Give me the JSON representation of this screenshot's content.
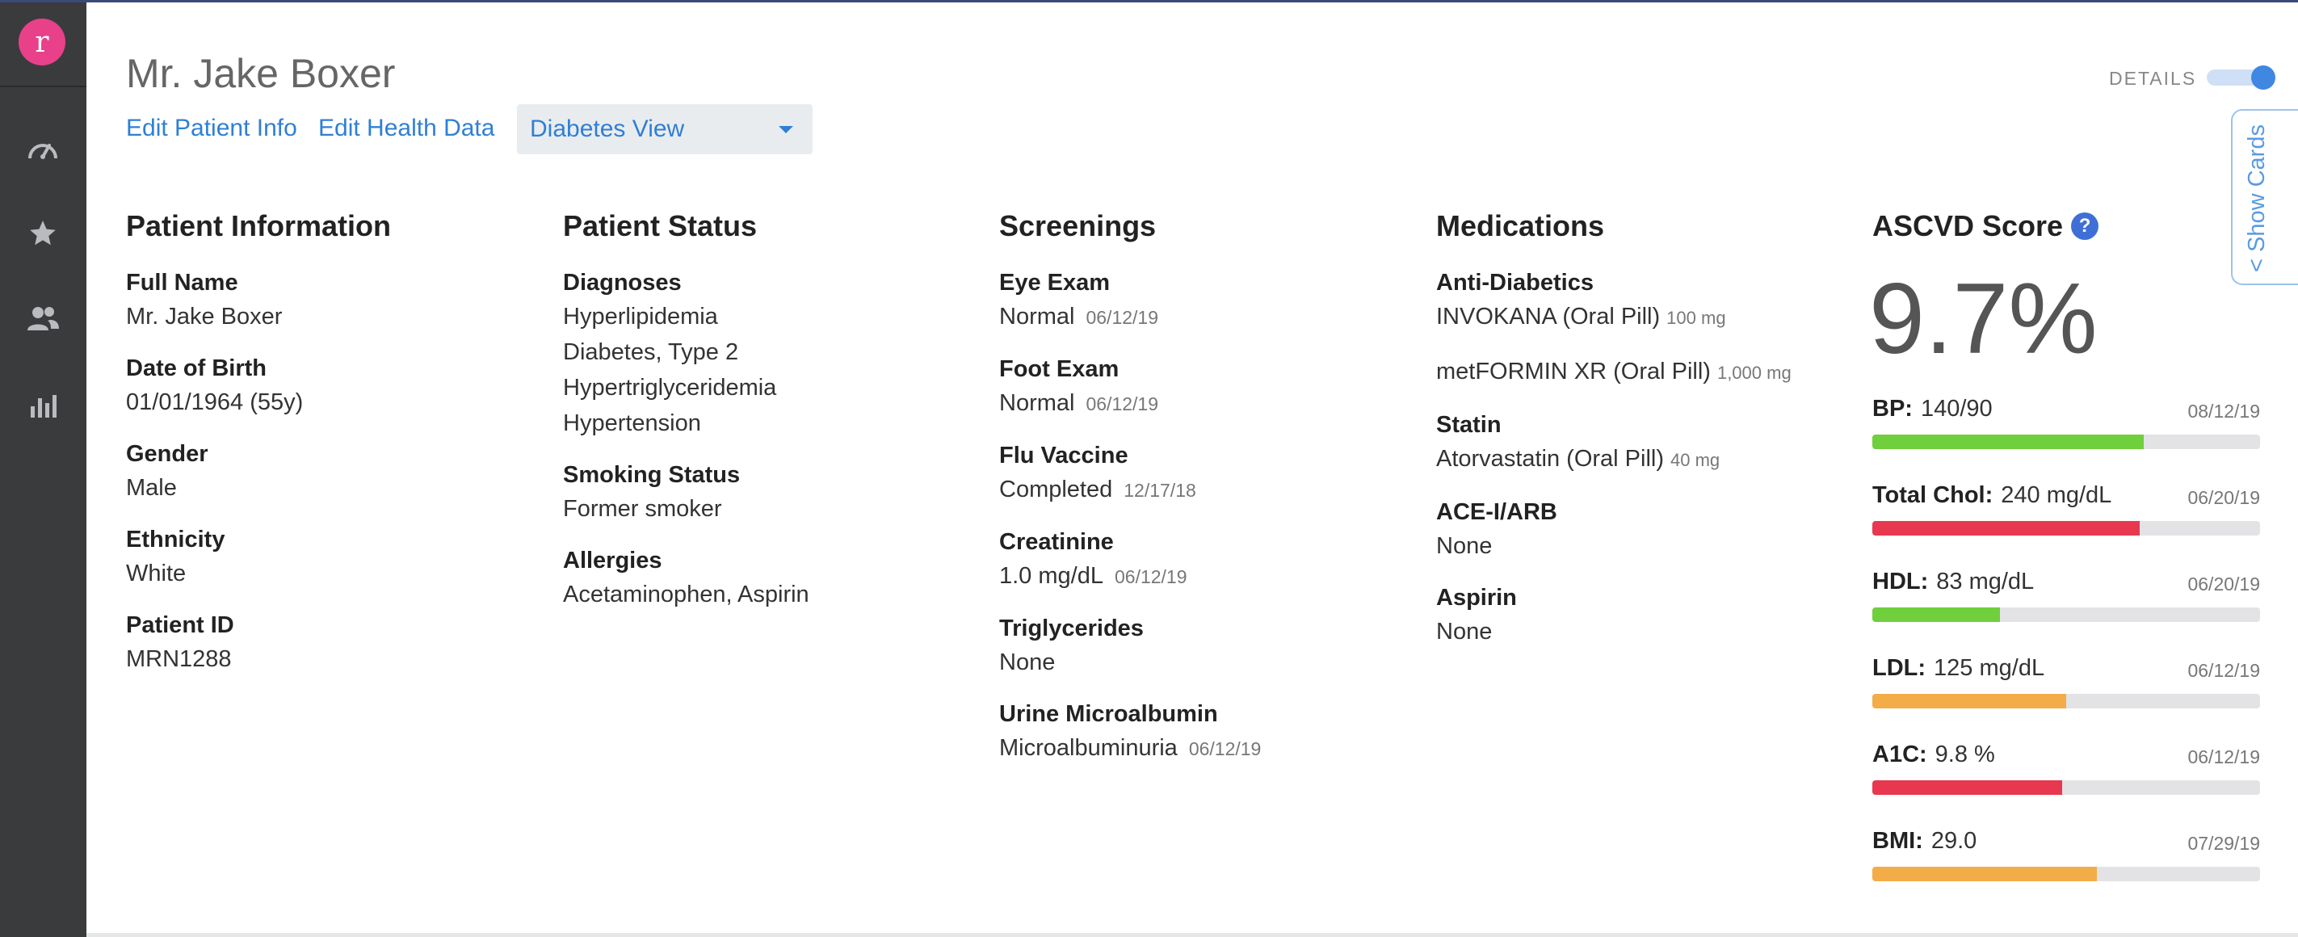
{
  "app": {
    "logo_letter": "r"
  },
  "sidebar": {
    "items": [
      {
        "name": "dashboard",
        "icon": "gauge-icon"
      },
      {
        "name": "favorites",
        "icon": "star-icon"
      },
      {
        "name": "patients",
        "icon": "users-icon"
      },
      {
        "name": "reports",
        "icon": "bar-chart-icon"
      }
    ]
  },
  "header": {
    "patient_name": "Mr. Jake Boxer",
    "edit_patient_label": "Edit Patient Info",
    "edit_health_label": "Edit Health Data",
    "view_selected": "Diabetes View",
    "details_label": "DETAILS",
    "details_on": true,
    "show_cards_label": "< Show Cards"
  },
  "patient_info": {
    "title": "Patient Information",
    "fields": [
      {
        "label": "Full Name",
        "value": "Mr. Jake Boxer"
      },
      {
        "label": "Date of Birth",
        "value": "01/01/1964 (55y)"
      },
      {
        "label": "Gender",
        "value": "Male"
      },
      {
        "label": "Ethnicity",
        "value": "White"
      },
      {
        "label": "Patient ID",
        "value": "MRN1288"
      }
    ]
  },
  "patient_status": {
    "title": "Patient Status",
    "diagnoses_label": "Diagnoses",
    "diagnoses": [
      "Hyperlipidemia",
      "Diabetes, Type 2",
      "Hypertriglyceridemia",
      "Hypertension"
    ],
    "smoking_label": "Smoking Status",
    "smoking_value": "Former smoker",
    "allergies_label": "Allergies",
    "allergies_value": "Acetaminophen, Aspirin"
  },
  "screenings": {
    "title": "Screenings",
    "items": [
      {
        "label": "Eye Exam",
        "value": "Normal",
        "date": "06/12/19"
      },
      {
        "label": "Foot Exam",
        "value": "Normal",
        "date": "06/12/19"
      },
      {
        "label": "Flu Vaccine",
        "value": "Completed",
        "date": "12/17/18"
      },
      {
        "label": "Creatinine",
        "value": "1.0 mg/dL",
        "date": "06/12/19"
      },
      {
        "label": "Triglycerides",
        "value": "None",
        "date": ""
      },
      {
        "label": "Urine Microalbumin",
        "value": "Microalbuminuria",
        "date": "06/12/19"
      }
    ]
  },
  "medications": {
    "title": "Medications",
    "anti_diabetics_label": "Anti-Diabetics",
    "anti_diabetics": [
      {
        "name": "INVOKANA (Oral Pill)",
        "dose": "100 mg"
      },
      {
        "name": "metFORMIN XR (Oral Pill)",
        "dose": "1,000 mg"
      }
    ],
    "statin_label": "Statin",
    "statin": {
      "name": "Atorvastatin (Oral Pill)",
      "dose": "40 mg"
    },
    "ace_label": "ACE-I/ARB",
    "ace_value": "None",
    "aspirin_label": "Aspirin",
    "aspirin_value": "None"
  },
  "ascvd": {
    "title": "ASCVD Score",
    "help_glyph": "?",
    "score": "9.7%",
    "metrics": [
      {
        "name": "BP:",
        "value": "140/90",
        "date": "08/12/19",
        "level": 0.7,
        "color": "#6fcf3c"
      },
      {
        "name": "Total Chol:",
        "value": "240 mg/dL",
        "date": "06/20/19",
        "level": 0.69,
        "color": "#e8384f"
      },
      {
        "name": "HDL:",
        "value": "83 mg/dL",
        "date": "06/20/19",
        "level": 0.33,
        "color": "#6fcf3c"
      },
      {
        "name": "LDL:",
        "value": "125 mg/dL",
        "date": "06/12/19",
        "level": 0.5,
        "color": "#f2ac48"
      },
      {
        "name": "A1C:",
        "value": "9.8 %",
        "date": "06/12/19",
        "level": 0.49,
        "color": "#e8384f"
      },
      {
        "name": "BMI:",
        "value": "29.0",
        "date": "07/29/19",
        "level": 0.58,
        "color": "#f2ac48"
      }
    ]
  },
  "colors": {
    "accent": "#2f7fd6",
    "sidebar": "#3a3b3d",
    "logo": "#e8418a"
  }
}
